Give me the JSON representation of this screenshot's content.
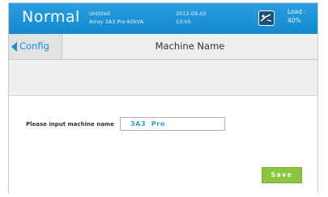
{
  "header": {
    "mode": "Normal",
    "project_name": "Untitled",
    "device_model": "Array 3A3 Pro 60kVA",
    "date": "2012-09-02",
    "time": "13:05",
    "load_label": "Load :",
    "load_value": "40%"
  },
  "nav": {
    "back_label": "Config",
    "title": "Machine Name"
  },
  "form": {
    "machine_name_label": "Please input machine name",
    "machine_name_value": "3A3  Pro",
    "save_label": "Save"
  },
  "colors": {
    "header_blue": "#1589cf",
    "save_green": "#8cc63f"
  },
  "icons": {
    "status_icon": "power-status-icon",
    "back_icon": "back-arrow-icon"
  }
}
